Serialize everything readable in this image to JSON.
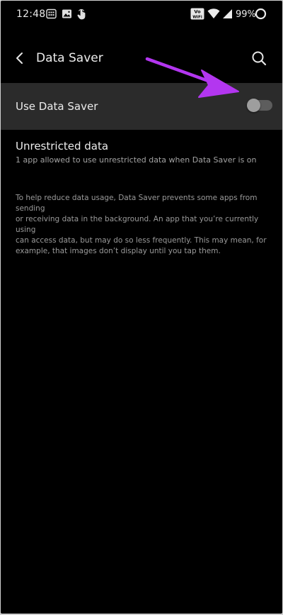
{
  "status_bar": {
    "time": "12:48",
    "battery_percent": "99%",
    "icons": [
      "calendar-grid-icon",
      "image-icon",
      "hand-touch-icon",
      "volte-wifi-icon",
      "wifi-icon",
      "battery-icon"
    ],
    "volte_top": "Vo",
    "volte_bottom": "WiFi"
  },
  "app_bar": {
    "title": "Data Saver",
    "back_icon": "back-arrow-icon",
    "search_icon": "search-icon"
  },
  "data_saver": {
    "label": "Use Data Saver",
    "enabled": false
  },
  "unrestricted": {
    "title": "Unrestricted data",
    "subtitle": "1 app allowed to use unrestricted data when Data Saver is on"
  },
  "info": {
    "lines": [
      "To help reduce data usage, Data Saver prevents some apps from sending",
      "or receiving data in the background. An app that you’re currently using",
      "can access data, but may do so less frequently. This may mean, for",
      "example, that images don’t display until you tap them."
    ]
  },
  "colors": {
    "background": "#000000",
    "row_highlight": "#2b2b2b",
    "arrow": "#b336f0",
    "toggle_track": "#5d5d5d",
    "toggle_thumb": "#9e9e9e"
  }
}
